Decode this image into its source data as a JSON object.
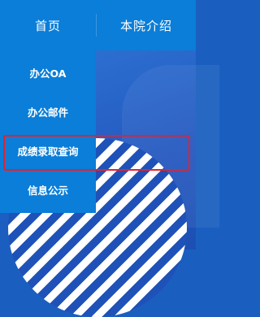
{
  "nav": {
    "items": [
      {
        "label": "首页"
      },
      {
        "label": "本院介绍"
      }
    ]
  },
  "dropdown": {
    "items": [
      {
        "label": "办公OA"
      },
      {
        "label": "办公邮件"
      },
      {
        "label": "成绩录取查询"
      },
      {
        "label": "信息公示"
      }
    ],
    "highlighted_index": 2
  },
  "colors": {
    "nav_bg": "#0a7ed8",
    "text": "#ffffff",
    "highlight_border": "#e8202a",
    "page_bg": "#1c62c6"
  }
}
